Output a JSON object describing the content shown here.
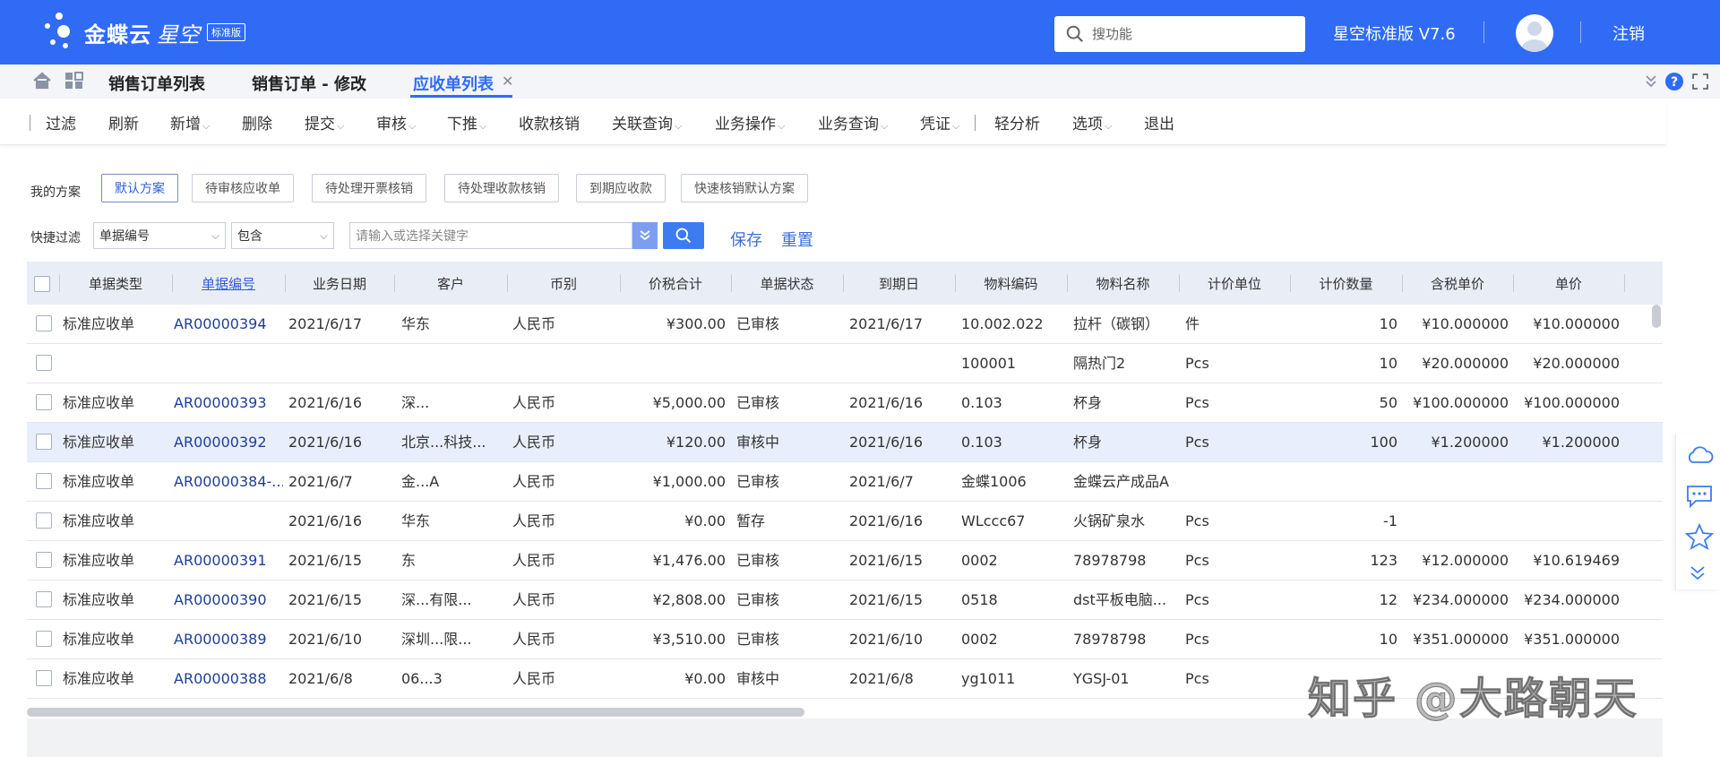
{
  "header": {
    "brand_name": "金蝶云",
    "brand_sub": "星空",
    "brand_badge": "标准版",
    "search_placeholder": "搜功能",
    "version": "星空标准版 V7.6",
    "logout": "注销",
    "bg_color": "#2f6bf5"
  },
  "tabs": [
    {
      "label": "销售订单列表",
      "active": false
    },
    {
      "label": "销售订单 - 修改",
      "active": false
    },
    {
      "label": "应收单列表",
      "active": true
    }
  ],
  "toolbar": {
    "items": [
      "过滤",
      "刷新",
      "新增",
      "删除",
      "提交",
      "审核",
      "下推",
      "收款核销",
      "关联查询",
      "业务操作",
      "业务查询",
      "凭证",
      "轻分析",
      "选项",
      "退出"
    ]
  },
  "schemes": {
    "label": "我的方案",
    "items": [
      "默认方案",
      "待审核应收单",
      "待处理开票核销",
      "待处理收款核销",
      "到期应收款",
      "快速核销默认方案"
    ]
  },
  "quick_filter": {
    "label": "快捷过滤",
    "field": "单据编号",
    "operator": "包含",
    "input_placeholder": "请输入或选择关键字",
    "save": "保存",
    "reset": "重置"
  },
  "grid": {
    "columns": [
      "单据类型",
      "单据编号",
      "业务日期",
      "客户",
      "币别",
      "价税合计",
      "单据状态",
      "到期日",
      "物料编码",
      "物料名称",
      "计价单位",
      "计价数量",
      "含税单价",
      "单价"
    ],
    "rows": [
      {
        "type": "标准应收单",
        "no": "AR00000394",
        "date": "2021/6/17",
        "customer": "华东",
        "currency": "人民币",
        "total": "¥300.00",
        "status": "已审核",
        "due": "2021/6/17",
        "mcode": "10.002.022",
        "mname": "拉杆（碳钢）",
        "unit": "件",
        "qty": "10",
        "taxprice": "¥10.000000",
        "price": "¥10.000000"
      },
      {
        "type": "",
        "no": "",
        "date": "",
        "customer": "",
        "currency": "",
        "total": "",
        "status": "",
        "due": "",
        "mcode": "100001",
        "mname": "隔热门2",
        "unit": "Pcs",
        "qty": "10",
        "taxprice": "¥20.000000",
        "price": "¥20.000000"
      },
      {
        "type": "标准应收单",
        "no": "AR00000393",
        "date": "2021/6/16",
        "customer": "深...",
        "currency": "人民币",
        "total": "¥5,000.00",
        "status": "已审核",
        "due": "2021/6/16",
        "mcode": "0.103",
        "mname": "杯身",
        "unit": "Pcs",
        "qty": "50",
        "taxprice": "¥100.000000",
        "price": "¥100.000000"
      },
      {
        "type": "标准应收单",
        "no": "AR00000392",
        "date": "2021/6/16",
        "customer": "北京...科技...",
        "currency": "人民币",
        "total": "¥120.00",
        "status": "审核中",
        "due": "2021/6/16",
        "mcode": "0.103",
        "mname": "杯身",
        "unit": "Pcs",
        "qty": "100",
        "taxprice": "¥1.200000",
        "price": "¥1.200000"
      },
      {
        "type": "标准应收单",
        "no": "AR00000384-...",
        "date": "2021/6/7",
        "customer": "金...A",
        "currency": "人民币",
        "total": "¥1,000.00",
        "status": "已审核",
        "due": "2021/6/7",
        "mcode": "金蝶1006",
        "mname": "金蝶云产成品A",
        "unit": "",
        "qty": "",
        "taxprice": "",
        "price": ""
      },
      {
        "type": "标准应收单",
        "no": "",
        "date": "2021/6/16",
        "customer": "华东",
        "currency": "人民币",
        "total": "¥0.00",
        "status": "暂存",
        "due": "2021/6/16",
        "mcode": "WLccc67",
        "mname": "火锅矿泉水",
        "unit": "Pcs",
        "qty": "-1",
        "taxprice": "",
        "price": ""
      },
      {
        "type": "标准应收单",
        "no": "AR00000391",
        "date": "2021/6/15",
        "customer": "东",
        "currency": "人民币",
        "total": "¥1,476.00",
        "status": "已审核",
        "due": "2021/6/15",
        "mcode": "0002",
        "mname": "78978798",
        "unit": "Pcs",
        "qty": "123",
        "taxprice": "¥12.000000",
        "price": "¥10.619469"
      },
      {
        "type": "标准应收单",
        "no": "AR00000390",
        "date": "2021/6/15",
        "customer": "深...有限...",
        "currency": "人民币",
        "total": "¥2,808.00",
        "status": "已审核",
        "due": "2021/6/15",
        "mcode": "0518",
        "mname": "dst平板电脑...",
        "unit": "Pcs",
        "qty": "12",
        "taxprice": "¥234.000000",
        "price": "¥234.000000"
      },
      {
        "type": "标准应收单",
        "no": "AR00000389",
        "date": "2021/6/10",
        "customer": "深圳...限...",
        "currency": "人民币",
        "total": "¥3,510.00",
        "status": "已审核",
        "due": "2021/6/10",
        "mcode": "0002",
        "mname": "78978798",
        "unit": "Pcs",
        "qty": "10",
        "taxprice": "¥351.000000",
        "price": "¥351.000000"
      },
      {
        "type": "标准应收单",
        "no": "AR00000388",
        "date": "2021/6/8",
        "customer": "06...3",
        "currency": "人民币",
        "total": "¥0.00",
        "status": "审核中",
        "due": "2021/6/8",
        "mcode": "yg1011",
        "mname": "YGSJ-01",
        "unit": "Pcs",
        "qty": "",
        "taxprice": "",
        "price": ""
      }
    ]
  },
  "watermark": "知乎 @大路朝天"
}
